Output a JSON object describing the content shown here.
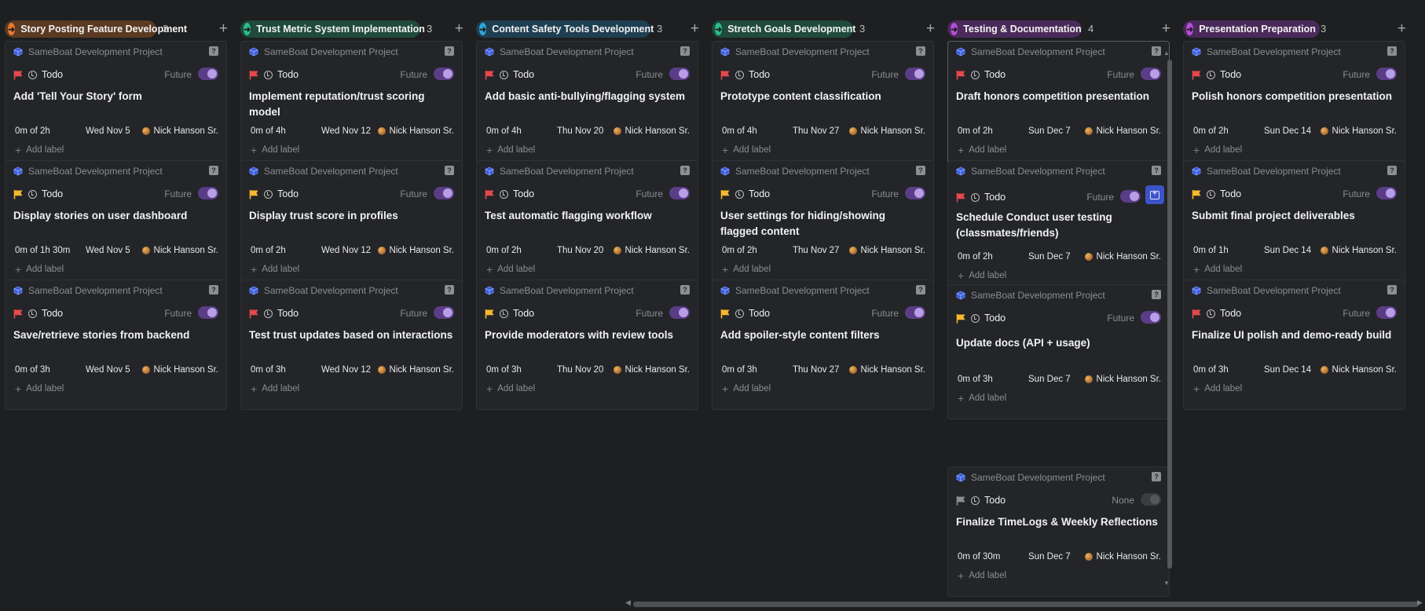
{
  "columns": [
    {
      "title": "Story Posting Feature Development",
      "count": "3",
      "color": "#e97a31",
      "pill_bg": "#5a3a22",
      "cards": [
        {
          "project": "SameBoat Development Project",
          "status": "Todo",
          "priority": "urgent",
          "schedule": "Future",
          "title": "Add 'Tell Your Story' form",
          "estimate": "0m of 2h",
          "due": "Wed Nov 5",
          "assignee": "Nick Hanson Sr.",
          "add_label": "Add label"
        },
        {
          "project": "SameBoat Development Project",
          "status": "Todo",
          "priority": "high",
          "schedule": "Future",
          "title": "Display stories on user dashboard",
          "estimate": "0m of 1h 30m",
          "due": "Wed Nov 5",
          "assignee": "Nick Hanson Sr.",
          "add_label": "Add label"
        },
        {
          "project": "SameBoat Development Project",
          "status": "Todo",
          "priority": "urgent",
          "schedule": "Future",
          "title": "Save/retrieve stories from backend",
          "estimate": "0m of 3h",
          "due": "Wed Nov 5",
          "assignee": "Nick Hanson Sr.",
          "add_label": "Add label"
        }
      ]
    },
    {
      "title": "Trust Metric System Implementation",
      "count": "3",
      "color": "#2bbd8a",
      "pill_bg": "#1f4a3c",
      "cards": [
        {
          "project": "SameBoat Development Project",
          "status": "Todo",
          "priority": "urgent",
          "schedule": "Future",
          "title": "Implement reputation/trust scoring model",
          "estimate": "0m of 4h",
          "due": "Wed Nov 12",
          "assignee": "Nick Hanson Sr.",
          "add_label": "Add label"
        },
        {
          "project": "SameBoat Development Project",
          "status": "Todo",
          "priority": "high",
          "schedule": "Future",
          "title": "Display trust score in profiles",
          "estimate": "0m of 2h",
          "due": "Wed Nov 12",
          "assignee": "Nick Hanson Sr.",
          "add_label": "Add label"
        },
        {
          "project": "SameBoat Development Project",
          "status": "Todo",
          "priority": "urgent",
          "schedule": "Future",
          "title": "Test trust updates based on interactions",
          "estimate": "0m of 3h",
          "due": "Wed Nov 12",
          "assignee": "Nick Hanson Sr.",
          "add_label": "Add label"
        }
      ]
    },
    {
      "title": "Content Safety Tools Development",
      "count": "3",
      "color": "#2ea7d8",
      "pill_bg": "#1e3f52",
      "cards": [
        {
          "project": "SameBoat Development Project",
          "status": "Todo",
          "priority": "urgent",
          "schedule": "Future",
          "title": "Add basic anti-bullying/flagging system",
          "estimate": "0m of 4h",
          "due": "Thu Nov 20",
          "assignee": "Nick Hanson Sr.",
          "add_label": "Add label"
        },
        {
          "project": "SameBoat Development Project",
          "status": "Todo",
          "priority": "urgent",
          "schedule": "Future",
          "title": "Test automatic flagging workflow",
          "estimate": "0m of 2h",
          "due": "Thu Nov 20",
          "assignee": "Nick Hanson Sr.",
          "add_label": "Add label"
        },
        {
          "project": "SameBoat Development Project",
          "status": "Todo",
          "priority": "high",
          "schedule": "Future",
          "title": "Provide moderators with review tools",
          "estimate": "0m of 3h",
          "due": "Thu Nov 20",
          "assignee": "Nick Hanson Sr.",
          "add_label": "Add label"
        }
      ]
    },
    {
      "title": "Stretch Goals Development",
      "count": "3",
      "color": "#2bbd8a",
      "pill_bg": "#1f4a3c",
      "cards": [
        {
          "project": "SameBoat Development Project",
          "status": "Todo",
          "priority": "urgent",
          "schedule": "Future",
          "title": "Prototype content classification",
          "estimate": "0m of 4h",
          "due": "Thu Nov 27",
          "assignee": "Nick Hanson Sr.",
          "add_label": "Add label"
        },
        {
          "project": "SameBoat Development Project",
          "status": "Todo",
          "priority": "high",
          "schedule": "Future",
          "title": "User settings for hiding/showing flagged content",
          "estimate": "0m of 2h",
          "due": "Thu Nov 27",
          "assignee": "Nick Hanson Sr.",
          "add_label": "Add label"
        },
        {
          "project": "SameBoat Development Project",
          "status": "Todo",
          "priority": "high",
          "schedule": "Future",
          "title": "Add spoiler-style content filters",
          "estimate": "0m of 3h",
          "due": "Thu Nov 27",
          "assignee": "Nick Hanson Sr.",
          "add_label": "Add label"
        }
      ]
    },
    {
      "title": "Testing & Documentation",
      "count": "4",
      "color": "#b64fd8",
      "pill_bg": "#4a2a5a",
      "cards": [
        {
          "project": "SameBoat Development Project",
          "status": "Todo",
          "priority": "urgent",
          "schedule": "Future",
          "title": "Draft honors competition presentation",
          "estimate": "0m of 2h",
          "due": "Sun Dec 7",
          "assignee": "Nick Hanson Sr.",
          "add_label": "Add label"
        },
        {
          "project": "SameBoat Development Project",
          "status": "Todo",
          "priority": "urgent",
          "schedule": "Future",
          "title": "Schedule Conduct user testing (classmates/friends)",
          "estimate": "0m of 2h",
          "due": "Sun Dec 7",
          "assignee": "Nick Hanson Sr.",
          "add_label": "Add label"
        },
        {
          "project": "SameBoat Development Project",
          "status": "Todo",
          "priority": "high",
          "schedule": "Future",
          "title": "Update docs (API + usage)",
          "estimate": "0m of 3h",
          "due": "Sun Dec 7",
          "assignee": "Nick Hanson Sr.",
          "add_label": "Add label"
        },
        {
          "project": "SameBoat Development Project",
          "status": "Todo",
          "priority": "none",
          "schedule": "None",
          "title": "Finalize TimeLogs & Weekly Reflections",
          "estimate": "0m of 30m",
          "due": "Sun Dec 7",
          "assignee": "Nick Hanson Sr.",
          "add_label": "Add label"
        }
      ]
    },
    {
      "title": "Presentation Preparation",
      "count": "3",
      "color": "#b64fd8",
      "pill_bg": "#4a2a5a",
      "cards": [
        {
          "project": "SameBoat Development Project",
          "status": "Todo",
          "priority": "urgent",
          "schedule": "Future",
          "title": "Polish honors competition presentation",
          "estimate": "0m of 2h",
          "due": "Sun Dec 14",
          "assignee": "Nick Hanson Sr.",
          "add_label": "Add label"
        },
        {
          "project": "SameBoat Development Project",
          "status": "Todo",
          "priority": "high",
          "schedule": "Future",
          "title": "Submit final project deliverables",
          "estimate": "0m of 1h",
          "due": "Sun Dec 14",
          "assignee": "Nick Hanson Sr.",
          "add_label": "Add label"
        },
        {
          "project": "SameBoat Development Project",
          "status": "Todo",
          "priority": "urgent",
          "schedule": "Future",
          "title": "Finalize UI polish and demo-ready build",
          "estimate": "0m of 3h",
          "due": "Sun Dec 14",
          "assignee": "Nick Hanson Sr.",
          "add_label": "Add label"
        }
      ]
    }
  ],
  "icons": {
    "column_status": "arrow-right-circle-icon",
    "project": "cube-icon",
    "help": "question-mark-icon",
    "priority": "flag-icon",
    "status": "clock-icon",
    "schedule": "toggle-icon",
    "calendar_add": "calendar-plus-icon",
    "assignee": "avatar-icon",
    "add": "plus-icon"
  },
  "priority_colors": {
    "urgent": "#e5484d",
    "high": "#f5b82e",
    "none": "#8b8d91"
  }
}
